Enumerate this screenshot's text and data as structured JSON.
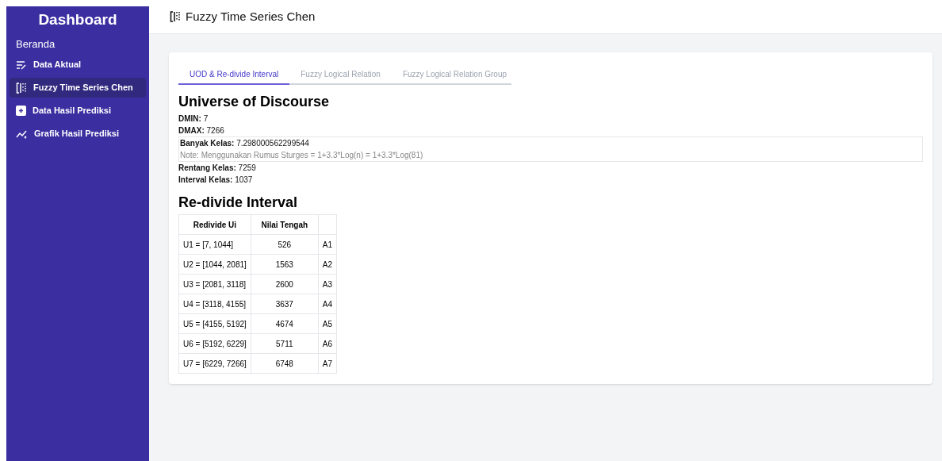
{
  "sidebar": {
    "title": "Dashboard",
    "section": "Beranda",
    "items": [
      {
        "label": "Data Aktual",
        "selected": false
      },
      {
        "label": "Fuzzy Time Series Chen",
        "selected": true
      },
      {
        "label": "Data Hasil Prediksi",
        "selected": false
      },
      {
        "label": "Grafik Hasil Prediksi",
        "selected": false
      }
    ]
  },
  "header": {
    "title": "Fuzzy Time Series Chen"
  },
  "tabs": [
    {
      "label": "UOD & Re-divide Interval",
      "selected": true
    },
    {
      "label": "Fuzzy Logical Relation",
      "selected": false
    },
    {
      "label": "Fuzzy Logical Relation Group",
      "selected": false
    }
  ],
  "uod": {
    "heading": "Universe of Discourse",
    "fields": [
      {
        "label": "DMIN:",
        "value": "7"
      },
      {
        "label": "DMAX:",
        "value": "7266"
      },
      {
        "label": "Banyak Kelas:",
        "value": "7.298000562299544",
        "note": "Note: Menggunakan Rumus Sturges = 1+3.3*Log(n) = 1+3.3*Log(81)"
      },
      {
        "label": "Rentang Kelas:",
        "value": "7259"
      },
      {
        "label": "Interval Kelas:",
        "value": "1037"
      }
    ]
  },
  "redivide": {
    "heading": "Re-divide Interval",
    "columns": [
      "Redivide Ui",
      "Nilai Tengah"
    ],
    "rows": [
      [
        "U1 = [7, 1044]",
        "526",
        "A1"
      ],
      [
        "U2 = [1044, 2081]",
        "1563",
        "A2"
      ],
      [
        "U3 = [2081, 3118]",
        "2600",
        "A3"
      ],
      [
        "U4 = [3118, 4155]",
        "3637",
        "A4"
      ],
      [
        "U5 = [4155, 5192]",
        "4674",
        "A5"
      ],
      [
        "U6 = [5192, 6229]",
        "5711",
        "A6"
      ],
      [
        "U7 = [6229, 7266]",
        "6748",
        "A7"
      ]
    ]
  }
}
